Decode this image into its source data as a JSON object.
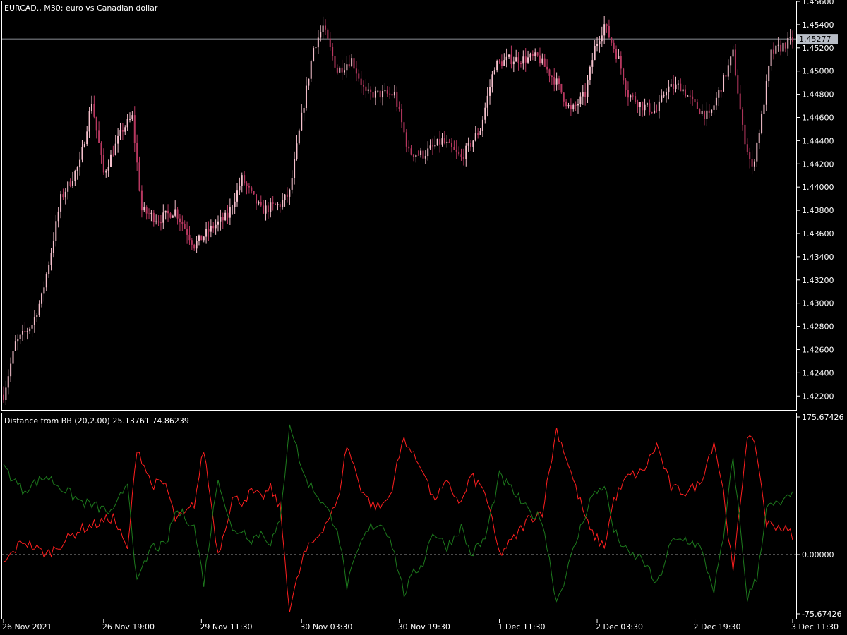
{
  "header": {
    "symbol": "EURCAD.",
    "timeframe": "M30",
    "description": "euro vs Canadian dollar"
  },
  "indicator": {
    "label": "Distance from BB (20,2.00)",
    "values": [
      25.13761,
      74.86239
    ]
  },
  "current_price": 1.45277,
  "colors": {
    "background": "#000000",
    "frame": "#ffffff",
    "candle": "#f5c0cc",
    "candle_alt": "#b83860",
    "series1": "#ff1f1f",
    "series2": "#1d7a1d",
    "price_line": "#b8bdc6",
    "zero_line": "#9a9a9a"
  },
  "chart_data": [
    {
      "type": "candlestick",
      "title": "EURCAD., M30:  euro vs Canadian dollar",
      "x_ticks": [
        "26 Nov 2021",
        "26 Nov 19:00",
        "29 Nov 11:30",
        "30 Nov 03:30",
        "30 Nov 19:30",
        "1 Dec 11:30",
        "2 Dec 03:30",
        "2 Dec 19:30",
        "3 Dec 11:30"
      ],
      "y_ticks": [
        "1.45600",
        "1.45400",
        "1.45200",
        "1.45000",
        "1.44800",
        "1.44600",
        "1.44400",
        "1.44200",
        "1.44000",
        "1.43800",
        "1.43600",
        "1.43400",
        "1.43200",
        "1.43000",
        "1.42800",
        "1.42600",
        "1.42400",
        "1.42200"
      ],
      "ylim": [
        1.4208,
        1.456
      ],
      "price_anchors": [
        {
          "bar": 0,
          "close": 1.4221
        },
        {
          "bar": 5,
          "close": 1.4265
        },
        {
          "bar": 12,
          "close": 1.4282
        },
        {
          "bar": 16,
          "close": 1.4305
        },
        {
          "bar": 20,
          "close": 1.4345
        },
        {
          "bar": 24,
          "close": 1.439
        },
        {
          "bar": 32,
          "close": 1.442
        },
        {
          "bar": 37,
          "close": 1.4474
        },
        {
          "bar": 42,
          "close": 1.4412
        },
        {
          "bar": 50,
          "close": 1.445
        },
        {
          "bar": 54,
          "close": 1.446
        },
        {
          "bar": 58,
          "close": 1.438
        },
        {
          "bar": 65,
          "close": 1.4372
        },
        {
          "bar": 72,
          "close": 1.438
        },
        {
          "bar": 80,
          "close": 1.435
        },
        {
          "bar": 88,
          "close": 1.4366
        },
        {
          "bar": 94,
          "close": 1.4375
        },
        {
          "bar": 100,
          "close": 1.4407
        },
        {
          "bar": 108,
          "close": 1.438
        },
        {
          "bar": 116,
          "close": 1.4385
        },
        {
          "bar": 120,
          "close": 1.4395
        },
        {
          "bar": 125,
          "close": 1.446
        },
        {
          "bar": 130,
          "close": 1.452
        },
        {
          "bar": 134,
          "close": 1.4538
        },
        {
          "bar": 140,
          "close": 1.45
        },
        {
          "bar": 146,
          "close": 1.451
        },
        {
          "bar": 152,
          "close": 1.448
        },
        {
          "bar": 158,
          "close": 1.448
        },
        {
          "bar": 164,
          "close": 1.448
        },
        {
          "bar": 170,
          "close": 1.443
        },
        {
          "bar": 176,
          "close": 1.4428
        },
        {
          "bar": 184,
          "close": 1.444
        },
        {
          "bar": 192,
          "close": 1.4425
        },
        {
          "bar": 200,
          "close": 1.445
        },
        {
          "bar": 206,
          "close": 1.4505
        },
        {
          "bar": 212,
          "close": 1.451
        },
        {
          "bar": 218,
          "close": 1.451
        },
        {
          "bar": 224,
          "close": 1.4512
        },
        {
          "bar": 232,
          "close": 1.449
        },
        {
          "bar": 238,
          "close": 1.4465
        },
        {
          "bar": 244,
          "close": 1.448
        },
        {
          "bar": 248,
          "close": 1.452
        },
        {
          "bar": 252,
          "close": 1.454
        },
        {
          "bar": 258,
          "close": 1.451
        },
        {
          "bar": 262,
          "close": 1.448
        },
        {
          "bar": 268,
          "close": 1.447
        },
        {
          "bar": 274,
          "close": 1.4465
        },
        {
          "bar": 278,
          "close": 1.4485
        },
        {
          "bar": 284,
          "close": 1.4487
        },
        {
          "bar": 290,
          "close": 1.447
        },
        {
          "bar": 296,
          "close": 1.446
        },
        {
          "bar": 302,
          "close": 1.4492
        },
        {
          "bar": 306,
          "close": 1.4515
        },
        {
          "bar": 310,
          "close": 1.445
        },
        {
          "bar": 314,
          "close": 1.4415
        },
        {
          "bar": 318,
          "close": 1.446
        },
        {
          "bar": 322,
          "close": 1.4515
        },
        {
          "bar": 327,
          "close": 1.4522
        },
        {
          "bar": 331,
          "close": 1.4527
        }
      ],
      "last_bar": 331
    },
    {
      "type": "line",
      "title": "Distance from BB (20,2.00)",
      "y_ticks": [
        "175.67426",
        "0.00000",
        "-75.67426"
      ],
      "ylim": [
        -75.67426,
        175.67426
      ],
      "series": [
        {
          "values_anchor": [
            {
              "bar": 0,
              "v": -12
            },
            {
              "bar": 8,
              "v": 18
            },
            {
              "bar": 18,
              "v": 0
            },
            {
              "bar": 32,
              "v": 32
            },
            {
              "bar": 40,
              "v": 40
            },
            {
              "bar": 46,
              "v": 48
            },
            {
              "bar": 52,
              "v": 5
            },
            {
              "bar": 56,
              "v": 138
            },
            {
              "bar": 62,
              "v": 90
            },
            {
              "bar": 68,
              "v": 90
            },
            {
              "bar": 72,
              "v": 45
            },
            {
              "bar": 76,
              "v": 50
            },
            {
              "bar": 80,
              "v": 65
            },
            {
              "bar": 84,
              "v": 135
            },
            {
              "bar": 90,
              "v": 0
            },
            {
              "bar": 96,
              "v": 72
            },
            {
              "bar": 100,
              "v": 68
            },
            {
              "bar": 104,
              "v": 80
            },
            {
              "bar": 108,
              "v": 72
            },
            {
              "bar": 112,
              "v": 84
            },
            {
              "bar": 116,
              "v": 60
            },
            {
              "bar": 120,
              "v": -70
            },
            {
              "bar": 126,
              "v": 0
            },
            {
              "bar": 132,
              "v": 25
            },
            {
              "bar": 140,
              "v": 65
            },
            {
              "bar": 144,
              "v": 140
            },
            {
              "bar": 150,
              "v": 85
            },
            {
              "bar": 154,
              "v": 65
            },
            {
              "bar": 158,
              "v": 60
            },
            {
              "bar": 162,
              "v": 75
            },
            {
              "bar": 168,
              "v": 150
            },
            {
              "bar": 172,
              "v": 125
            },
            {
              "bar": 176,
              "v": 110
            },
            {
              "bar": 180,
              "v": 70
            },
            {
              "bar": 186,
              "v": 90
            },
            {
              "bar": 192,
              "v": 65
            },
            {
              "bar": 196,
              "v": 100
            },
            {
              "bar": 202,
              "v": 80
            },
            {
              "bar": 208,
              "v": 0
            },
            {
              "bar": 214,
              "v": 20
            },
            {
              "bar": 220,
              "v": 45
            },
            {
              "bar": 226,
              "v": 55
            },
            {
              "bar": 232,
              "v": 160
            },
            {
              "bar": 236,
              "v": 125
            },
            {
              "bar": 240,
              "v": 85
            },
            {
              "bar": 246,
              "v": 30
            },
            {
              "bar": 252,
              "v": 10
            },
            {
              "bar": 256,
              "v": 70
            },
            {
              "bar": 262,
              "v": 100
            },
            {
              "bar": 268,
              "v": 105
            },
            {
              "bar": 274,
              "v": 140
            },
            {
              "bar": 280,
              "v": 85
            },
            {
              "bar": 286,
              "v": 80
            },
            {
              "bar": 292,
              "v": 90
            },
            {
              "bar": 298,
              "v": 145
            },
            {
              "bar": 302,
              "v": 80
            },
            {
              "bar": 306,
              "v": -25
            },
            {
              "bar": 312,
              "v": 155
            },
            {
              "bar": 316,
              "v": 130
            },
            {
              "bar": 320,
              "v": 40
            },
            {
              "bar": 326,
              "v": 35
            },
            {
              "bar": 331,
              "v": 25.13761
            }
          ]
        },
        {
          "values_anchor": [
            {
              "bar": 0,
              "v": 112
            },
            {
              "bar": 8,
              "v": 82
            },
            {
              "bar": 18,
              "v": 100
            },
            {
              "bar": 32,
              "v": 68
            },
            {
              "bar": 40,
              "v": 60
            },
            {
              "bar": 46,
              "v": 52
            },
            {
              "bar": 52,
              "v": 95
            },
            {
              "bar": 56,
              "v": -38
            },
            {
              "bar": 62,
              "v": 10
            },
            {
              "bar": 68,
              "v": 10
            },
            {
              "bar": 72,
              "v": 55
            },
            {
              "bar": 76,
              "v": 50
            },
            {
              "bar": 80,
              "v": 35
            },
            {
              "bar": 84,
              "v": -35
            },
            {
              "bar": 90,
              "v": 100
            },
            {
              "bar": 96,
              "v": 28
            },
            {
              "bar": 100,
              "v": 32
            },
            {
              "bar": 104,
              "v": 20
            },
            {
              "bar": 108,
              "v": 28
            },
            {
              "bar": 112,
              "v": 16
            },
            {
              "bar": 116,
              "v": 40
            },
            {
              "bar": 120,
              "v": 170
            },
            {
              "bar": 126,
              "v": 100
            },
            {
              "bar": 132,
              "v": 75
            },
            {
              "bar": 140,
              "v": 35
            },
            {
              "bar": 144,
              "v": -40
            },
            {
              "bar": 150,
              "v": 15
            },
            {
              "bar": 154,
              "v": 35
            },
            {
              "bar": 158,
              "v": 40
            },
            {
              "bar": 162,
              "v": 25
            },
            {
              "bar": 168,
              "v": -50
            },
            {
              "bar": 172,
              "v": -25
            },
            {
              "bar": 176,
              "v": -10
            },
            {
              "bar": 180,
              "v": 30
            },
            {
              "bar": 186,
              "v": 10
            },
            {
              "bar": 192,
              "v": 35
            },
            {
              "bar": 196,
              "v": 0
            },
            {
              "bar": 202,
              "v": 20
            },
            {
              "bar": 208,
              "v": 100
            },
            {
              "bar": 214,
              "v": 80
            },
            {
              "bar": 220,
              "v": 55
            },
            {
              "bar": 226,
              "v": 45
            },
            {
              "bar": 232,
              "v": -60
            },
            {
              "bar": 236,
              "v": -25
            },
            {
              "bar": 240,
              "v": 15
            },
            {
              "bar": 246,
              "v": 70
            },
            {
              "bar": 252,
              "v": 90
            },
            {
              "bar": 256,
              "v": 30
            },
            {
              "bar": 262,
              "v": 0
            },
            {
              "bar": 268,
              "v": -5
            },
            {
              "bar": 274,
              "v": -40
            },
            {
              "bar": 280,
              "v": 15
            },
            {
              "bar": 286,
              "v": 20
            },
            {
              "bar": 292,
              "v": 10
            },
            {
              "bar": 298,
              "v": -45
            },
            {
              "bar": 302,
              "v": 20
            },
            {
              "bar": 306,
              "v": 125
            },
            {
              "bar": 312,
              "v": -55
            },
            {
              "bar": 316,
              "v": -30
            },
            {
              "bar": 320,
              "v": 60
            },
            {
              "bar": 326,
              "v": 65
            },
            {
              "bar": 331,
              "v": 74.86239
            }
          ]
        }
      ]
    }
  ]
}
